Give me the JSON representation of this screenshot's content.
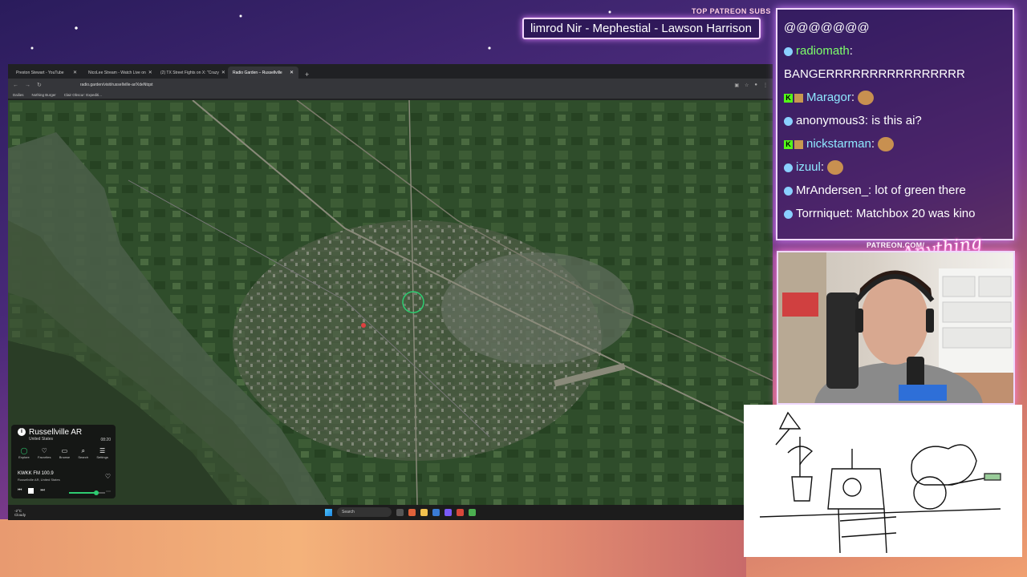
{
  "overlay": {
    "patreon_label": "TOP PATREON SUBS",
    "sub_names": "limrod Nir - Mephestial - Lawson Harrison",
    "patreon_url": "PATREON.COM/",
    "logo_text": "Anything Else"
  },
  "browser": {
    "tabs": [
      {
        "label": "Preston Stewart - YouTube",
        "active": false
      },
      {
        "label": "NicoLee Stream - Watch Live on",
        "active": false
      },
      {
        "label": "(2) TX Street Fights on X: \"Crazy",
        "active": false
      },
      {
        "label": "Radio Garden – Russellville",
        "active": true
      }
    ],
    "url": "radio.garden/visit/russellville-ar/XdeNtqst",
    "bookmarks": [
      "Dailies",
      "Nothing Burger",
      "Clair Obscur: Expediti..."
    ]
  },
  "radio": {
    "city": "Russellville AR",
    "country": "United States",
    "time": "08:20",
    "nav": [
      {
        "label": "Explore",
        "icon": "explore-icon",
        "glyph": "◯"
      },
      {
        "label": "Favorites",
        "icon": "heart-icon",
        "glyph": "♡"
      },
      {
        "label": "Browse",
        "icon": "browse-icon",
        "glyph": "▭"
      },
      {
        "label": "Search",
        "icon": "search-icon",
        "glyph": "⌕"
      },
      {
        "label": "Settings",
        "icon": "settings-icon",
        "glyph": "☰"
      }
    ],
    "station": "KWKK FM 100.9",
    "station_location": "Russellville AR, United States",
    "volume": 0.75,
    "accent": "#2ecc71"
  },
  "taskbar": {
    "weather_temp": "-2°C",
    "weather_desc": "Cloudy",
    "search_placeholder": "Search"
  },
  "chat": {
    "messages": [
      {
        "user": "@@@@@@@",
        "text": "",
        "badge": "none",
        "color": "#ffffff"
      },
      {
        "user": "radiomath",
        "text": "BANGERRRRRRRRRRRRRRRR",
        "badge": "dot",
        "color": "#7dff6a"
      },
      {
        "user": "Maragor",
        "text": "",
        "badge": "kick",
        "color": "#8ee8ff"
      },
      {
        "user": "anonymous3",
        "text": "is this ai?",
        "badge": "dot",
        "color": "#ffffff"
      },
      {
        "user": "nickstarman",
        "text": "",
        "badge": "kick",
        "color": "#8ee8ff"
      },
      {
        "user": "izuul",
        "text": "",
        "badge": "dot",
        "color": "#8ee8ff"
      },
      {
        "user": "MrAndersen_",
        "text": "lot of green there",
        "badge": "dot",
        "color": "#ffffff"
      },
      {
        "user": "Torrniquet",
        "text": "Matchbox 20 was kino",
        "badge": "dot",
        "color": "#ffffff"
      }
    ]
  }
}
